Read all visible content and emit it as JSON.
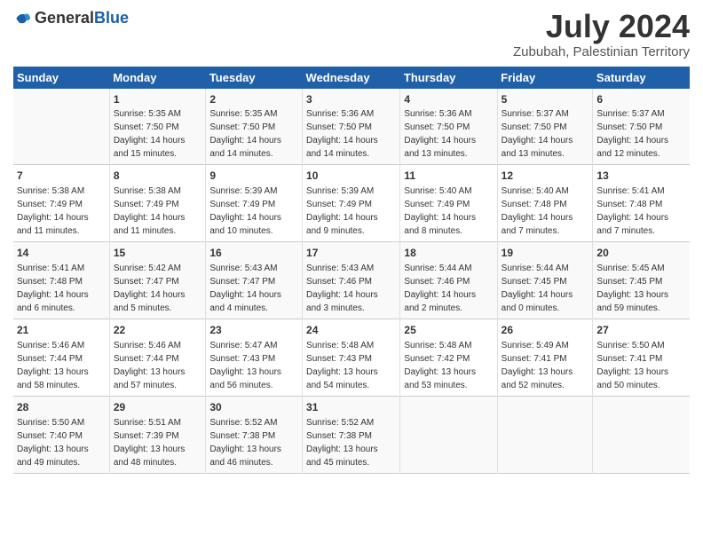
{
  "header": {
    "logo_general": "General",
    "logo_blue": "Blue",
    "main_title": "July 2024",
    "subtitle": "Zububah, Palestinian Territory"
  },
  "days_of_week": [
    "Sunday",
    "Monday",
    "Tuesday",
    "Wednesday",
    "Thursday",
    "Friday",
    "Saturday"
  ],
  "weeks": [
    [
      {
        "day": "",
        "info": ""
      },
      {
        "day": "1",
        "info": "Sunrise: 5:35 AM\nSunset: 7:50 PM\nDaylight: 14 hours\nand 15 minutes."
      },
      {
        "day": "2",
        "info": "Sunrise: 5:35 AM\nSunset: 7:50 PM\nDaylight: 14 hours\nand 14 minutes."
      },
      {
        "day": "3",
        "info": "Sunrise: 5:36 AM\nSunset: 7:50 PM\nDaylight: 14 hours\nand 14 minutes."
      },
      {
        "day": "4",
        "info": "Sunrise: 5:36 AM\nSunset: 7:50 PM\nDaylight: 14 hours\nand 13 minutes."
      },
      {
        "day": "5",
        "info": "Sunrise: 5:37 AM\nSunset: 7:50 PM\nDaylight: 14 hours\nand 13 minutes."
      },
      {
        "day": "6",
        "info": "Sunrise: 5:37 AM\nSunset: 7:50 PM\nDaylight: 14 hours\nand 12 minutes."
      }
    ],
    [
      {
        "day": "7",
        "info": "Sunrise: 5:38 AM\nSunset: 7:49 PM\nDaylight: 14 hours\nand 11 minutes."
      },
      {
        "day": "8",
        "info": "Sunrise: 5:38 AM\nSunset: 7:49 PM\nDaylight: 14 hours\nand 11 minutes."
      },
      {
        "day": "9",
        "info": "Sunrise: 5:39 AM\nSunset: 7:49 PM\nDaylight: 14 hours\nand 10 minutes."
      },
      {
        "day": "10",
        "info": "Sunrise: 5:39 AM\nSunset: 7:49 PM\nDaylight: 14 hours\nand 9 minutes."
      },
      {
        "day": "11",
        "info": "Sunrise: 5:40 AM\nSunset: 7:49 PM\nDaylight: 14 hours\nand 8 minutes."
      },
      {
        "day": "12",
        "info": "Sunrise: 5:40 AM\nSunset: 7:48 PM\nDaylight: 14 hours\nand 7 minutes."
      },
      {
        "day": "13",
        "info": "Sunrise: 5:41 AM\nSunset: 7:48 PM\nDaylight: 14 hours\nand 7 minutes."
      }
    ],
    [
      {
        "day": "14",
        "info": "Sunrise: 5:41 AM\nSunset: 7:48 PM\nDaylight: 14 hours\nand 6 minutes."
      },
      {
        "day": "15",
        "info": "Sunrise: 5:42 AM\nSunset: 7:47 PM\nDaylight: 14 hours\nand 5 minutes."
      },
      {
        "day": "16",
        "info": "Sunrise: 5:43 AM\nSunset: 7:47 PM\nDaylight: 14 hours\nand 4 minutes."
      },
      {
        "day": "17",
        "info": "Sunrise: 5:43 AM\nSunset: 7:46 PM\nDaylight: 14 hours\nand 3 minutes."
      },
      {
        "day": "18",
        "info": "Sunrise: 5:44 AM\nSunset: 7:46 PM\nDaylight: 14 hours\nand 2 minutes."
      },
      {
        "day": "19",
        "info": "Sunrise: 5:44 AM\nSunset: 7:45 PM\nDaylight: 14 hours\nand 0 minutes."
      },
      {
        "day": "20",
        "info": "Sunrise: 5:45 AM\nSunset: 7:45 PM\nDaylight: 13 hours\nand 59 minutes."
      }
    ],
    [
      {
        "day": "21",
        "info": "Sunrise: 5:46 AM\nSunset: 7:44 PM\nDaylight: 13 hours\nand 58 minutes."
      },
      {
        "day": "22",
        "info": "Sunrise: 5:46 AM\nSunset: 7:44 PM\nDaylight: 13 hours\nand 57 minutes."
      },
      {
        "day": "23",
        "info": "Sunrise: 5:47 AM\nSunset: 7:43 PM\nDaylight: 13 hours\nand 56 minutes."
      },
      {
        "day": "24",
        "info": "Sunrise: 5:48 AM\nSunset: 7:43 PM\nDaylight: 13 hours\nand 54 minutes."
      },
      {
        "day": "25",
        "info": "Sunrise: 5:48 AM\nSunset: 7:42 PM\nDaylight: 13 hours\nand 53 minutes."
      },
      {
        "day": "26",
        "info": "Sunrise: 5:49 AM\nSunset: 7:41 PM\nDaylight: 13 hours\nand 52 minutes."
      },
      {
        "day": "27",
        "info": "Sunrise: 5:50 AM\nSunset: 7:41 PM\nDaylight: 13 hours\nand 50 minutes."
      }
    ],
    [
      {
        "day": "28",
        "info": "Sunrise: 5:50 AM\nSunset: 7:40 PM\nDaylight: 13 hours\nand 49 minutes."
      },
      {
        "day": "29",
        "info": "Sunrise: 5:51 AM\nSunset: 7:39 PM\nDaylight: 13 hours\nand 48 minutes."
      },
      {
        "day": "30",
        "info": "Sunrise: 5:52 AM\nSunset: 7:38 PM\nDaylight: 13 hours\nand 46 minutes."
      },
      {
        "day": "31",
        "info": "Sunrise: 5:52 AM\nSunset: 7:38 PM\nDaylight: 13 hours\nand 45 minutes."
      },
      {
        "day": "",
        "info": ""
      },
      {
        "day": "",
        "info": ""
      },
      {
        "day": "",
        "info": ""
      }
    ]
  ]
}
